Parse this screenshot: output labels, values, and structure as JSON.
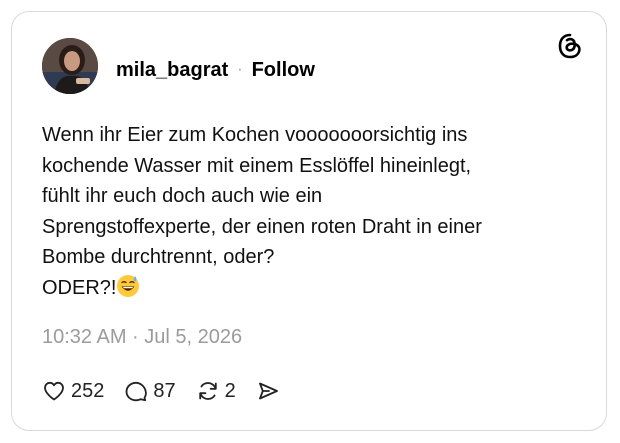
{
  "post": {
    "username": "mila_bagrat",
    "separator": "·",
    "follow_label": "Follow",
    "text": "Wenn ihr Eier zum Kochen vooooooorsichtig ins\nkochende Wasser mit einem Esslöffel hineinlegt,\nfühlt ihr euch doch auch wie ein\nSprengstoffexperte, der einen roten Draht in einer\nBombe durchtrennt, oder?\nODER?!",
    "emoji": "grinning-face-with-sweat",
    "timestamp": "10:32 AM · Jul 5, 2026"
  },
  "actions": {
    "likes": "252",
    "replies": "87",
    "reposts": "2"
  },
  "icons": {
    "logo": "threads-logo-icon",
    "like": "heart-icon",
    "reply": "comment-bubble-icon",
    "repost": "repost-icon",
    "share": "send-icon"
  },
  "colors": {
    "text": "#111111",
    "muted": "#9b9b9b",
    "border": "#d9d9d9"
  }
}
